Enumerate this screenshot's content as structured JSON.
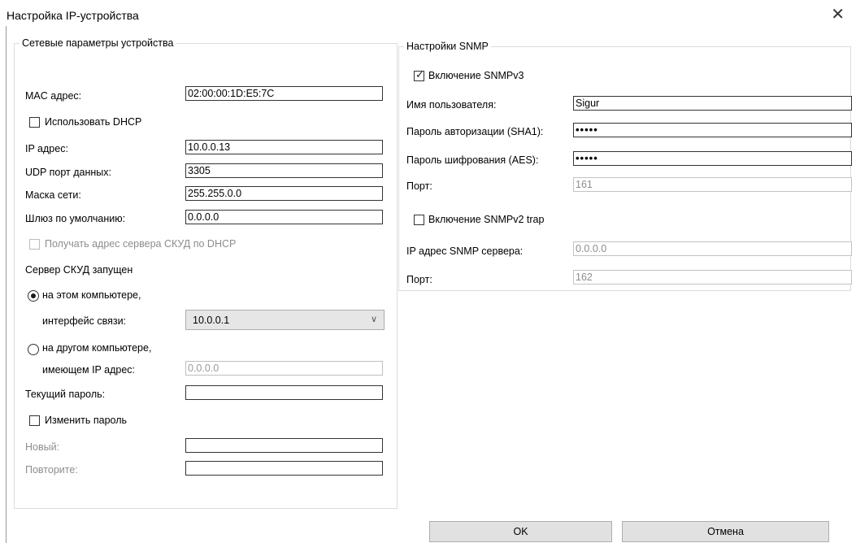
{
  "window": {
    "title": "Настройка IP-устройства",
    "close_glyph": "✕"
  },
  "network": {
    "legend": "Сетевые параметры устройства",
    "mac_label": "MAC адрес:",
    "mac_value": "02:00:00:1D:E5:7C",
    "dhcp_label": "Использовать DHCP",
    "dhcp_checked": false,
    "ip_label": "IP адрес:",
    "ip_value": "10.0.0.13",
    "udp_label": "UDP порт данных:",
    "udp_value": "3305",
    "mask_label": "Маска сети:",
    "mask_value": "255.255.0.0",
    "gateway_label": "Шлюз по умолчанию:",
    "gateway_value": "0.0.0.0",
    "acs_dhcp_label": "Получать адрес сервера СКУД по DHCP",
    "server_label": "Сервер СКУД запущен",
    "this_pc_label": "на этом компьютере,",
    "iface_label": "интерфейс связи:",
    "iface_value": "10.0.0.1",
    "other_pc_label": "на другом компьютере,",
    "other_ip_label": "имеющем IP адрес:",
    "other_ip_value": "0.0.0.0",
    "cur_pass_label": "Текущий пароль:",
    "change_pass_label": "Изменить пароль",
    "new_label": "Новый:",
    "repeat_label": "Повторите:"
  },
  "snmp": {
    "legend": "Настройки SNMP",
    "v3_label": "Включение SNMPv3",
    "v3_checked": true,
    "user_label": "Имя пользователя:",
    "user_value": "Sigur",
    "auth_label": "Пароль авторизации (SHA1):",
    "auth_value": "•••••",
    "enc_label": "Пароль шифрования (AES):",
    "enc_value": "•••••",
    "port_label": "Порт:",
    "port_value": "161",
    "v2_label": "Включение SNMPv2 trap",
    "v2_checked": false,
    "server_ip_label": "IP адрес SNMP сервера:",
    "server_ip_value": "0.0.0.0",
    "port2_label": "Порт:",
    "port2_value": "162"
  },
  "buttons": {
    "ok": "OK",
    "cancel": "Отмена"
  },
  "icons": {
    "close": "close-icon",
    "check": "checkmark-icon",
    "radio": "radio-dot-icon",
    "dropdown": "chevron-down-icon"
  }
}
